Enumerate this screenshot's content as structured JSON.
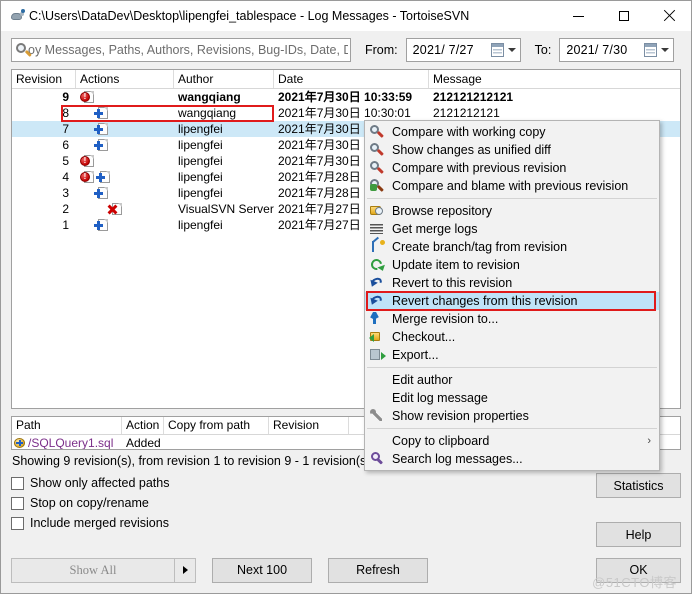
{
  "window": {
    "title": "C:\\Users\\DataDev\\Desktop\\lipengfei_tablespace - Log Messages - TortoiseSVN",
    "minimize_label": "─",
    "maximize_label": "□",
    "close_label": "✕"
  },
  "filterbar": {
    "search_placeholder": "oy Messages, Paths, Authors, Revisions, Bug-IDs, Date, Dat",
    "search_value": "",
    "from_label": "From:",
    "from_date": "2021/ 7/27",
    "to_label": "To:",
    "to_date": "2021/ 7/30"
  },
  "log": {
    "columns": [
      "Revision",
      "Actions",
      "Author",
      "Date",
      "Message"
    ],
    "rows": [
      {
        "revision": "9",
        "actions": [
          "modified"
        ],
        "author": "wangqiang",
        "date": "2021年7月30日 10:33:59",
        "message": "212121212121",
        "bold": true,
        "selected": false
      },
      {
        "revision": "8",
        "actions": [
          "added"
        ],
        "author": "wangqiang",
        "date": "2021年7月30日 10:30:01",
        "message": "2121212121",
        "bold": false,
        "selected": false
      },
      {
        "revision": "7",
        "actions": [
          "added"
        ],
        "author": "lipengfei",
        "date": "2021年7月30日",
        "message": "",
        "bold": false,
        "selected": true
      },
      {
        "revision": "6",
        "actions": [
          "added"
        ],
        "author": "lipengfei",
        "date": "2021年7月30日",
        "message": "",
        "bold": false,
        "selected": false
      },
      {
        "revision": "5",
        "actions": [
          "modified"
        ],
        "author": "lipengfei",
        "date": "2021年7月30日",
        "message": "",
        "bold": false,
        "selected": false
      },
      {
        "revision": "4",
        "actions": [
          "modified",
          "added"
        ],
        "author": "lipengfei",
        "date": "2021年7月28日",
        "message": "",
        "bold": false,
        "selected": false
      },
      {
        "revision": "3",
        "actions": [
          "added"
        ],
        "author": "lipengfei",
        "date": "2021年7月28日",
        "message": "",
        "bold": false,
        "selected": false
      },
      {
        "revision": "2",
        "actions": [
          "deleted"
        ],
        "author": "VisualSVN Server",
        "date": "2021年7月27日",
        "message": "",
        "bold": false,
        "selected": false
      },
      {
        "revision": "1",
        "actions": [
          "added"
        ],
        "author": "lipengfei",
        "date": "2021年7月27日",
        "message": "",
        "bold": false,
        "selected": false
      }
    ]
  },
  "paths": {
    "columns": [
      "Path",
      "Action",
      "Copy from path",
      "Revision"
    ],
    "rows": [
      {
        "path": "/SQLQuery1.sql",
        "action": "Added",
        "copy_from_path": "",
        "revision": ""
      }
    ]
  },
  "status": {
    "text": "Showing 9 revision(s), from revision 1 to revision 9 - 1 revision(s) selected, showing 1 changed paths"
  },
  "options": {
    "show_only_affected_paths": "Show only affected paths",
    "stop_on_copy_rename": "Stop on copy/rename",
    "include_merged_revisions": "Include merged revisions"
  },
  "buttons": {
    "statistics": "Statistics",
    "help": "Help",
    "show_all": "Show All",
    "next_100": "Next 100",
    "refresh": "Refresh",
    "ok": "OK"
  },
  "context_menu": {
    "items": [
      {
        "label": "Compare with working copy",
        "icon": "magnifier-icon",
        "highlighted": false,
        "submenu": false
      },
      {
        "label": "Show changes as unified diff",
        "icon": "magnifier-icon",
        "highlighted": false,
        "submenu": false
      },
      {
        "label": "Compare with previous revision",
        "icon": "magnifier-icon",
        "highlighted": false,
        "submenu": false
      },
      {
        "label": "Compare and blame with previous revision",
        "icon": "magnifier-blame-icon",
        "highlighted": false,
        "submenu": false
      },
      {
        "separator": true
      },
      {
        "label": "Browse repository",
        "icon": "folder-lock-icon",
        "highlighted": false,
        "submenu": false
      },
      {
        "label": "Get merge logs",
        "icon": "lines-icon",
        "highlighted": false,
        "submenu": false
      },
      {
        "label": "Create branch/tag from revision",
        "icon": "branch-icon",
        "highlighted": false,
        "submenu": false
      },
      {
        "label": "Update item to revision",
        "icon": "update-arrow-icon",
        "highlighted": false,
        "submenu": false
      },
      {
        "label": "Revert to this revision",
        "icon": "revert-arrow-icon",
        "highlighted": false,
        "submenu": false
      },
      {
        "label": "Revert changes from this revision",
        "icon": "revert-arrow-icon",
        "highlighted": true,
        "submenu": false
      },
      {
        "label": "Merge revision to...",
        "icon": "merge-icon",
        "highlighted": false,
        "submenu": false
      },
      {
        "label": "Checkout...",
        "icon": "checkout-icon",
        "highlighted": false,
        "submenu": false
      },
      {
        "label": "Export...",
        "icon": "export-icon",
        "highlighted": false,
        "submenu": false
      },
      {
        "separator": true
      },
      {
        "label": "Edit author",
        "icon": "none",
        "highlighted": false,
        "submenu": false
      },
      {
        "label": "Edit log message",
        "icon": "none",
        "highlighted": false,
        "submenu": false
      },
      {
        "label": "Show revision properties",
        "icon": "wrench-icon",
        "highlighted": false,
        "submenu": false
      },
      {
        "separator": true
      },
      {
        "label": "Copy to clipboard",
        "icon": "none",
        "highlighted": false,
        "submenu": true,
        "submenu_mark": "›"
      },
      {
        "label": "Search log messages...",
        "icon": "search-lens-icon",
        "highlighted": false,
        "submenu": false
      }
    ]
  },
  "watermark": {
    "text": "@51CTO博客"
  }
}
